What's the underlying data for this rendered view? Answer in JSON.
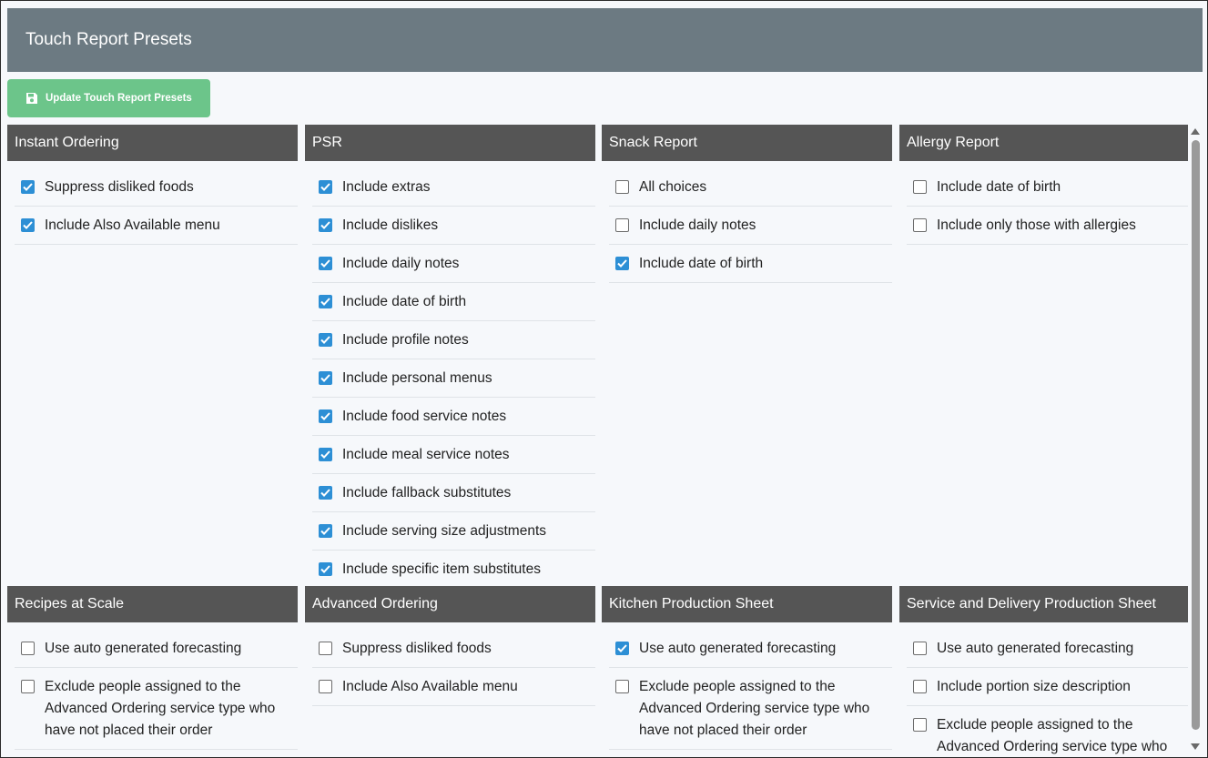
{
  "page": {
    "title": "Touch Report Presets",
    "update_button_label": "Update Touch Report Presets"
  },
  "colors": {
    "titlebar": "#6c7a82",
    "button": "#6cc58a",
    "panel_header": "#555555",
    "checkbox_checked": "#2d8fd5"
  },
  "panels": [
    {
      "title": "Instant Ordering",
      "items": [
        {
          "label": "Suppress disliked foods",
          "checked": true
        },
        {
          "label": "Include Also Available menu",
          "checked": true
        }
      ]
    },
    {
      "title": "PSR",
      "items": [
        {
          "label": "Include extras",
          "checked": true
        },
        {
          "label": "Include dislikes",
          "checked": true
        },
        {
          "label": "Include daily notes",
          "checked": true
        },
        {
          "label": "Include date of birth",
          "checked": true
        },
        {
          "label": "Include profile notes",
          "checked": true
        },
        {
          "label": "Include personal menus",
          "checked": true
        },
        {
          "label": "Include food service notes",
          "checked": true
        },
        {
          "label": "Include meal service notes",
          "checked": true
        },
        {
          "label": "Include fallback substitutes",
          "checked": true
        },
        {
          "label": "Include serving size adjustments",
          "checked": true
        },
        {
          "label": "Include specific item substitutes",
          "checked": true
        }
      ]
    },
    {
      "title": "Snack Report",
      "items": [
        {
          "label": "All choices",
          "checked": false
        },
        {
          "label": "Include daily notes",
          "checked": false
        },
        {
          "label": "Include date of birth",
          "checked": true
        }
      ]
    },
    {
      "title": "Allergy Report",
      "items": [
        {
          "label": "Include date of birth",
          "checked": false
        },
        {
          "label": "Include only those with allergies",
          "checked": false
        }
      ]
    },
    {
      "title": "Recipes at Scale",
      "items": [
        {
          "label": "Use auto generated forecasting",
          "checked": false
        },
        {
          "label": "Exclude people assigned to the Advanced Ordering service type who have not placed their order",
          "checked": false
        }
      ]
    },
    {
      "title": "Advanced Ordering",
      "items": [
        {
          "label": "Suppress disliked foods",
          "checked": false
        },
        {
          "label": "Include Also Available menu",
          "checked": false
        }
      ]
    },
    {
      "title": "Kitchen Production Sheet",
      "items": [
        {
          "label": "Use auto generated forecasting",
          "checked": true
        },
        {
          "label": "Exclude people assigned to the Advanced Ordering service type who have not placed their order",
          "checked": false
        }
      ]
    },
    {
      "title": "Service and Delivery Production Sheet",
      "items": [
        {
          "label": "Use auto generated forecasting",
          "checked": false
        },
        {
          "label": "Include portion size description",
          "checked": false
        },
        {
          "label": "Exclude people assigned to the Advanced Ordering service type who have not placed their order",
          "checked": false
        }
      ]
    }
  ]
}
